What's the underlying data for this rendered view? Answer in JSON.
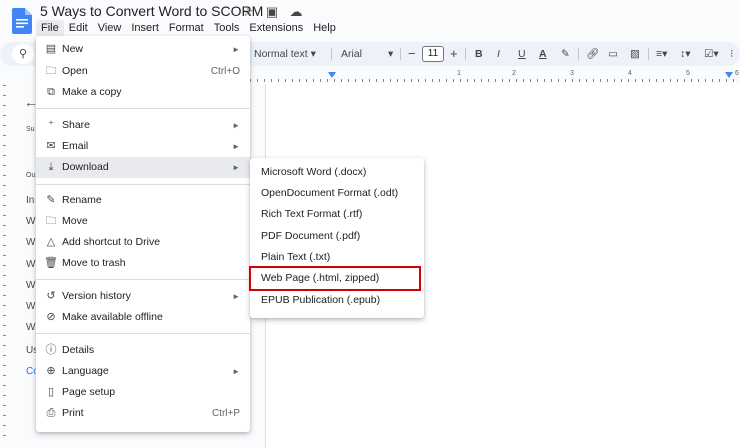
{
  "doc": {
    "title": "5 Ways to Convert Word to SCORM",
    "star_icon": "star-icon",
    "folder_icon": "move-to-folder-icon",
    "cloud_icon": "cloud-status-icon"
  },
  "menubar": [
    "File",
    "Edit",
    "View",
    "Insert",
    "Format",
    "Tools",
    "Extensions",
    "Help"
  ],
  "toolbar": {
    "style_select": "Normal text",
    "font_select": "Arial",
    "font_size": "11",
    "minus": "−",
    "plus": "+",
    "bold": "B",
    "italic": "I",
    "underline": "U",
    "text_color": "A"
  },
  "ruler": {
    "numbers": [
      "1",
      "1",
      "2",
      "3",
      "4",
      "5",
      "6"
    ]
  },
  "outline": {
    "lines": [
      "Su",
      "Ou",
      "In",
      "W",
      "W",
      "W",
      "W",
      "W",
      "W",
      "Us",
      "Co"
    ]
  },
  "file_menu": {
    "items": [
      {
        "label": "New",
        "icon": "new-doc-icon",
        "arrow": "►"
      },
      {
        "label": "Open",
        "icon": "folder-open-icon",
        "shortcut": "Ctrl+O"
      },
      {
        "label": "Make a copy",
        "icon": "copy-icon"
      },
      {
        "label": "Share",
        "icon": "share-person-icon",
        "arrow": "►"
      },
      {
        "label": "Email",
        "icon": "email-icon",
        "arrow": "►"
      },
      {
        "label": "Download",
        "icon": "download-icon",
        "arrow": "►"
      },
      {
        "label": "Rename",
        "icon": "rename-pencil-icon"
      },
      {
        "label": "Move",
        "icon": "move-folder-icon"
      },
      {
        "label": "Add shortcut to Drive",
        "icon": "drive-shortcut-icon"
      },
      {
        "label": "Move to trash",
        "icon": "trash-icon"
      },
      {
        "label": "Version history",
        "icon": "history-icon",
        "arrow": "►"
      },
      {
        "label": "Make available offline",
        "icon": "offline-icon"
      },
      {
        "label": "Details",
        "icon": "info-icon"
      },
      {
        "label": "Language",
        "icon": "globe-icon",
        "arrow": "►"
      },
      {
        "label": "Page setup",
        "icon": "page-setup-icon"
      },
      {
        "label": "Print",
        "icon": "print-icon",
        "shortcut": "Ctrl+P"
      }
    ]
  },
  "download_menu": {
    "items": [
      "Microsoft Word (.docx)",
      "OpenDocument Format (.odt)",
      "Rich Text Format (.rtf)",
      "PDF Document (.pdf)",
      "Plain Text (.txt)",
      "Web Page (.html, zipped)",
      "EPUB Publication (.epub)"
    ],
    "highlighted": "Web Page (.html, zipped)",
    "highlight_color": "#d50000"
  },
  "colors": {
    "accent": "#4285f4",
    "doc_icon": "#4285f4",
    "menu_hover": "#e8eaed"
  }
}
